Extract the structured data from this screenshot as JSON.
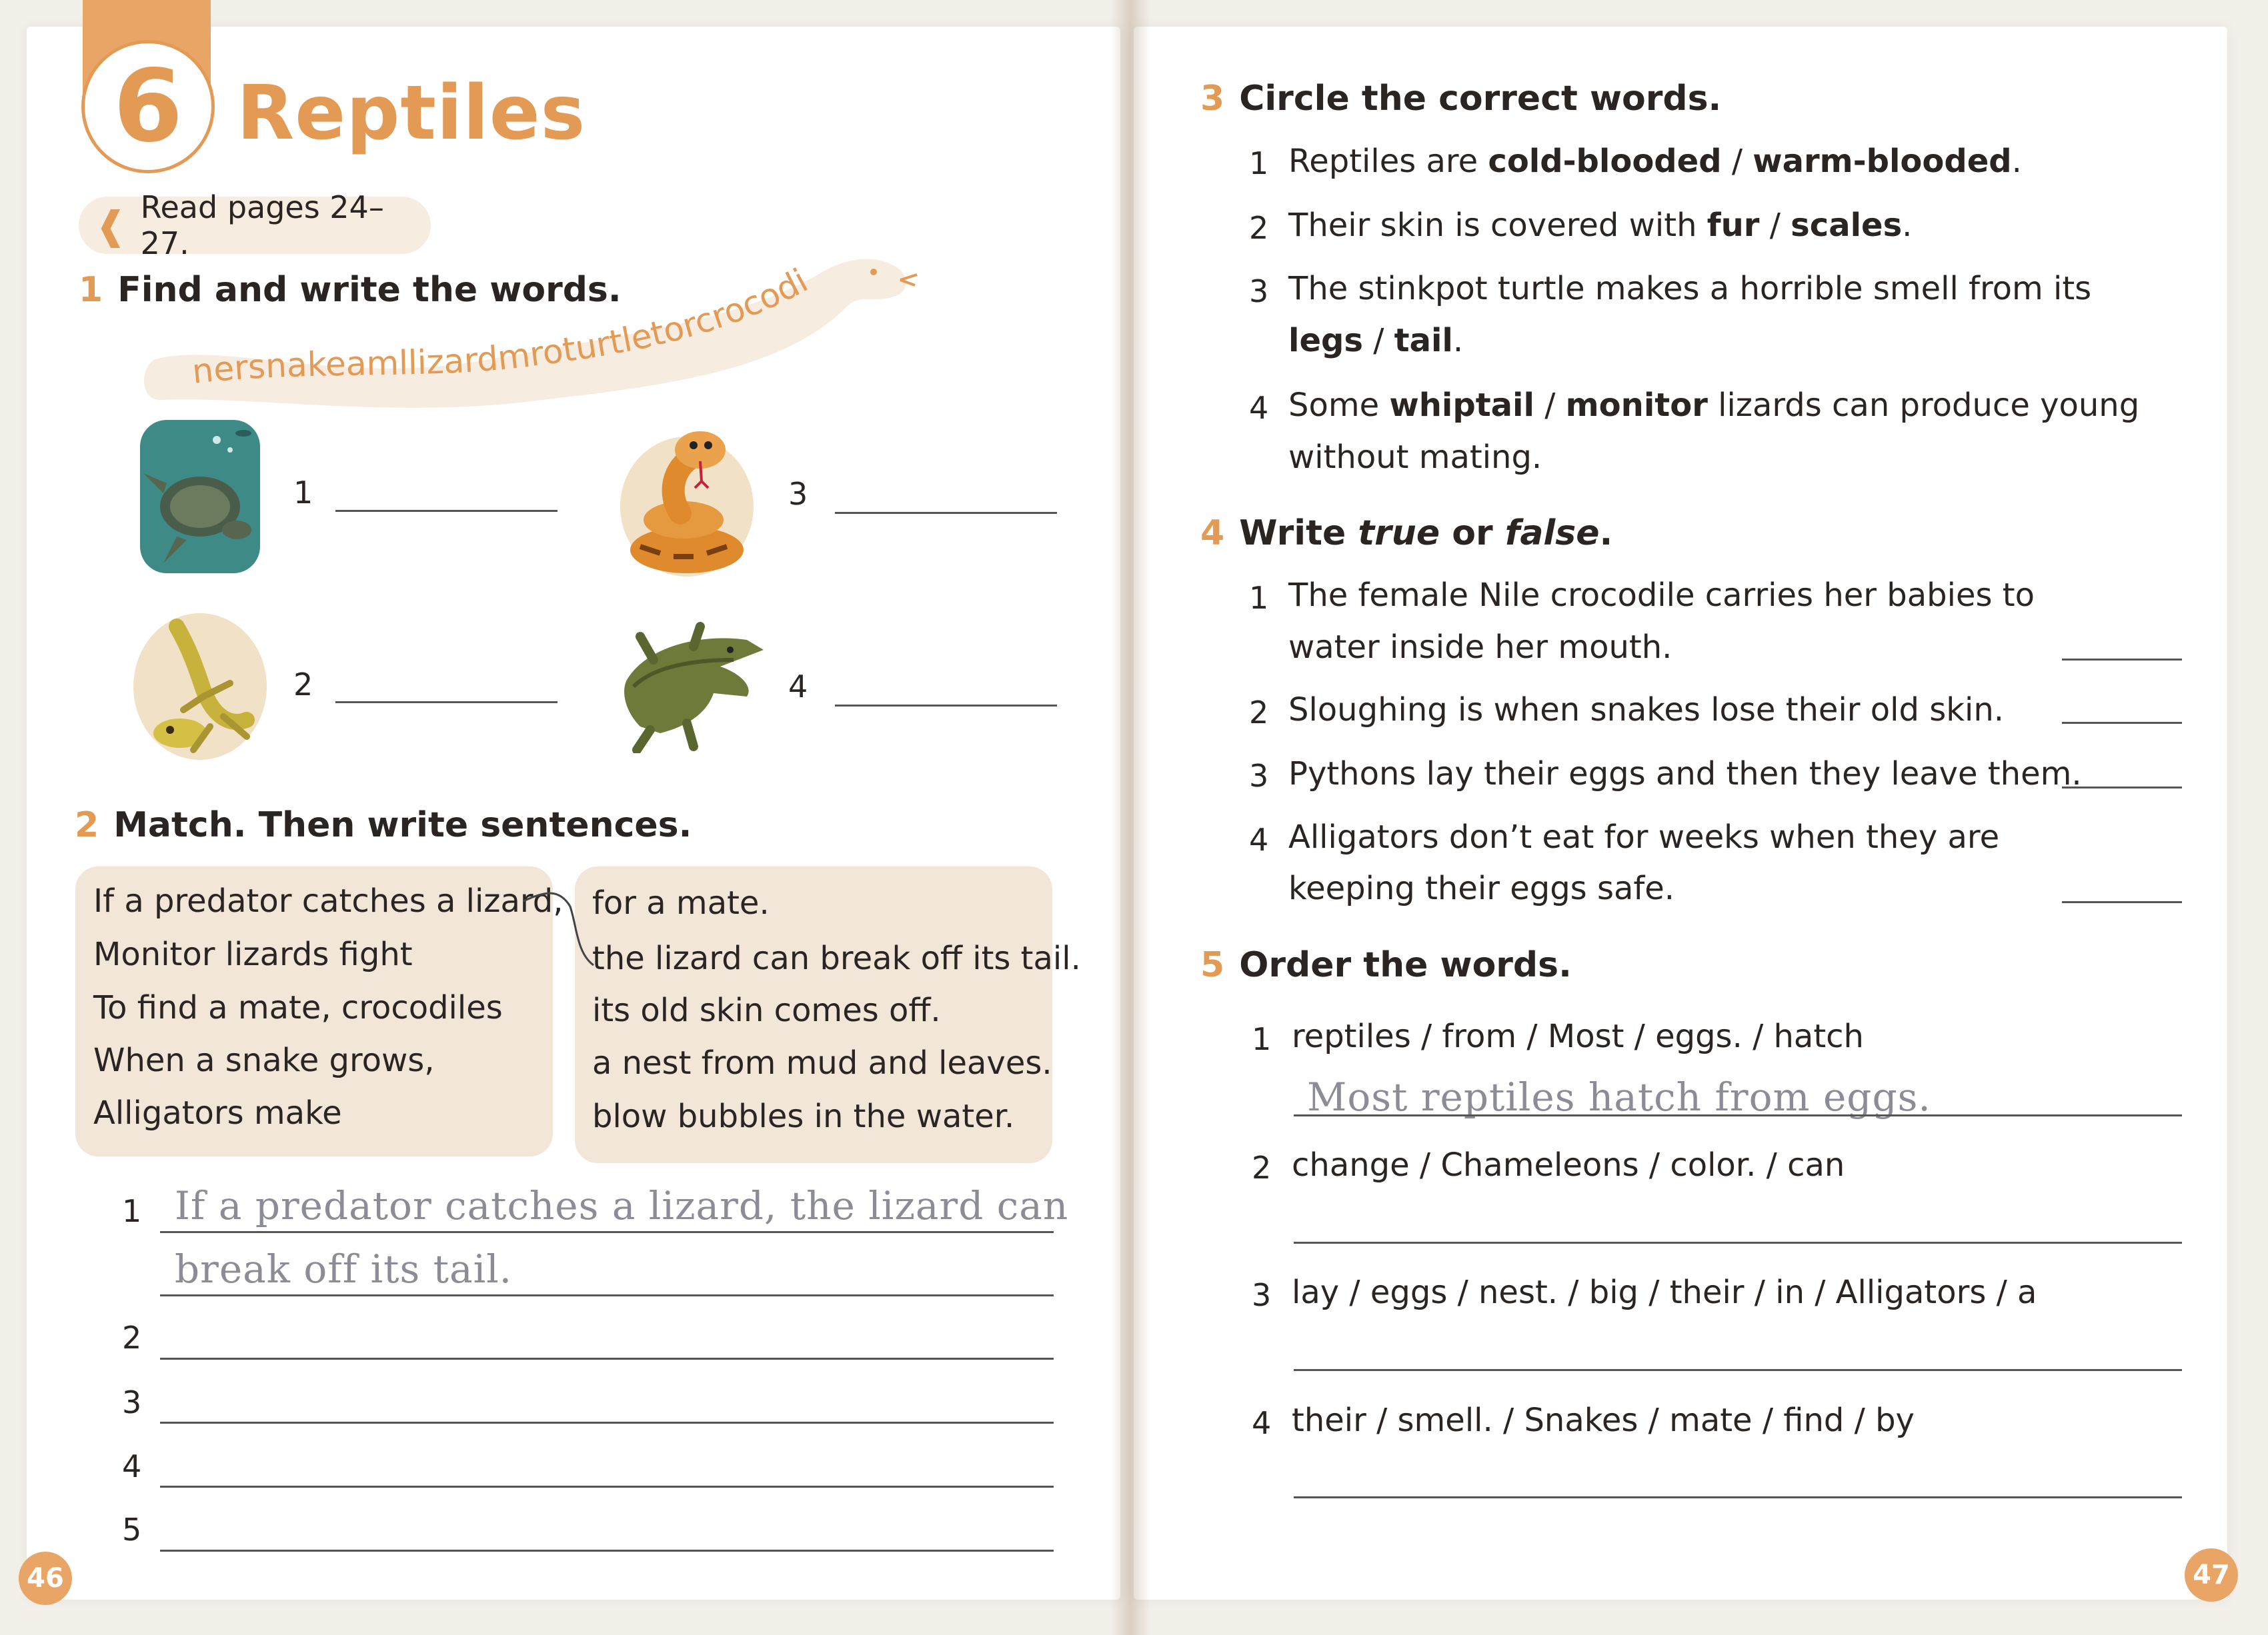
{
  "unit": {
    "number": "6",
    "title": "Reptiles"
  },
  "read_note": "Read pages 24–27.",
  "ex1": {
    "num": "1",
    "heading": "Find and write the words.",
    "word_strip": "nersnakeamllizardmroturtletorcrocodilert",
    "items": [
      {
        "num": "1",
        "picture": "turtle-illustration"
      },
      {
        "num": "2",
        "picture": "lizard-illustration"
      },
      {
        "num": "3",
        "picture": "snake-illustration"
      },
      {
        "num": "4",
        "picture": "crocodile-illustration"
      }
    ]
  },
  "ex2": {
    "num": "2",
    "heading": "Match. Then write sentences.",
    "left": [
      "If a predator catches a lizard,",
      "Monitor lizards fight",
      "To find a mate, crocodiles",
      "When a snake grows,",
      "Alligators make"
    ],
    "right": [
      "for a mate.",
      "the lizard can break off its tail.",
      "its old skin comes off.",
      "a nest from mud and leaves.",
      "blow bubbles in the water."
    ],
    "answers": [
      {
        "num": "1",
        "line1": "If a predator catches a lizard, the lizard can",
        "line2": "break off its tail."
      },
      {
        "num": "2"
      },
      {
        "num": "3"
      },
      {
        "num": "4"
      },
      {
        "num": "5"
      }
    ]
  },
  "ex3": {
    "num": "3",
    "heading": "Circle the correct words.",
    "items": [
      {
        "num": "1",
        "pre": "Reptiles are ",
        "opt1": "cold-blooded",
        "sep": " / ",
        "opt2": "warm-blooded",
        "post": "."
      },
      {
        "num": "2",
        "pre": "Their skin is covered with ",
        "opt1": "fur",
        "sep": " / ",
        "opt2": "scales",
        "post": "."
      },
      {
        "num": "3",
        "pre": "The stinkpot turtle makes a horrible smell from its",
        "opt1": "legs",
        "sep": " / ",
        "opt2": "tail",
        "post": "."
      },
      {
        "num": "4",
        "pre": "Some ",
        "opt1": "whiptail",
        "sep": " / ",
        "opt2": "monitor",
        "post": " lizards can produce young",
        "line2": "without mating."
      }
    ]
  },
  "ex4": {
    "num": "4",
    "heading_pre": "Write ",
    "heading_true": "true",
    "heading_mid": " or ",
    "heading_false": "false",
    "heading_post": ".",
    "items": [
      {
        "num": "1",
        "line1": "The female Nile crocodile carries her babies to",
        "line2": "water inside her mouth."
      },
      {
        "num": "2",
        "line1": "Sloughing is when snakes lose their old skin."
      },
      {
        "num": "3",
        "line1": "Pythons lay their eggs and then they leave them."
      },
      {
        "num": "4",
        "line1": "Alligators don’t eat for weeks when they are",
        "line2": "keeping their eggs safe."
      }
    ]
  },
  "ex5": {
    "num": "5",
    "heading": "Order the words.",
    "items": [
      {
        "num": "1",
        "words": "reptiles / from / Most / eggs. / hatch",
        "answer": "Most reptiles hatch from eggs."
      },
      {
        "num": "2",
        "words": "change / Chameleons / color. / can"
      },
      {
        "num": "3",
        "words": "lay / eggs / nest. / big / their / in / Alligators / a"
      },
      {
        "num": "4",
        "words": "their / smell. / Snakes / mate / find / by"
      }
    ]
  },
  "page_numbers": {
    "left": "46",
    "right": "47"
  },
  "colors": {
    "accent": "#e39a55",
    "match_box": "#f2e6d9",
    "handwriting": "#8b8c95"
  }
}
